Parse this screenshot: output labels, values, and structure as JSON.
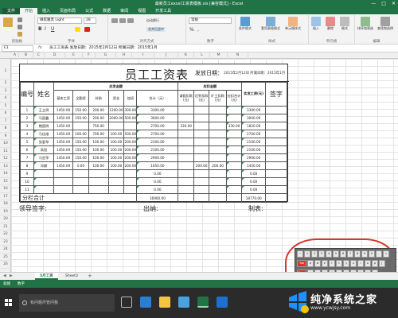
{
  "window": {
    "title": "最新员工excel工资表模板.xls [兼容模式] - Excel",
    "btn_min": "—",
    "btn_max": "□",
    "btn_close": "✕"
  },
  "ribbon_tabs": [
    "文件",
    "开始",
    "插入",
    "页面布局",
    "公式",
    "数据",
    "审阅",
    "视图",
    "开发工具"
  ],
  "ribbon": {
    "font_name": "微软雅黑 Light",
    "font_size": "28",
    "groups": [
      "剪贴板",
      "字体",
      "对齐方式",
      "数字",
      "样式",
      "单元格",
      "编辑"
    ],
    "wrap_text": "自动换行",
    "merge_center": "合并后居中",
    "number_format": "常规",
    "cond_format": "条件格式",
    "table_format": "套用表格格式",
    "cell_style": "单元格样式",
    "insert": "插入",
    "delete": "删除",
    "format": "格式",
    "sort_filter": "排序和筛选",
    "find_select": "查找和选择"
  },
  "formula_bar": {
    "name_box": "E1",
    "fx": "fx",
    "content": "员工工资表   发放日期：2015年2月12日 所属日期：2015年1月"
  },
  "columns": [
    "A",
    "B",
    "C",
    "D",
    "E",
    "F",
    "G",
    "H",
    "I",
    "J",
    "K",
    "L",
    "M",
    "N"
  ],
  "rows": [
    "1",
    "2",
    "3",
    "4",
    "5",
    "6",
    "7",
    "8",
    "9",
    "10",
    "11",
    "12",
    "13",
    "14",
    "15",
    "16",
    "17",
    "18",
    "19",
    "20",
    "21",
    "22",
    "23",
    "24",
    "25",
    "26",
    "27",
    "28",
    "29"
  ],
  "sheet": {
    "title": "员工工资表",
    "issue_label": "发放日期：",
    "issue_value": "2015年2月12日 所属日期：2015年1月",
    "headers": {
      "index": "编号",
      "name": "姓名",
      "payable": "应发金额",
      "deduct": "应扣金额",
      "base": "基本工资",
      "full_attend": "全勤奖",
      "subsidy": "补助",
      "bonus": "奖金",
      "overtime": "加班",
      "total": "合计（元）",
      "leave": "请假扣款(元)",
      "late": "迟到扣款(元)",
      "absent": "旷工扣款(元)",
      "deduct_total": "应扣合计(元)",
      "net": "实发工资(元)",
      "sign": "签字"
    },
    "rows": [
      {
        "no": "1",
        "name": "王立明",
        "base": "1450.00",
        "full": "150.00",
        "sub": "200.00",
        "bonus": "1200.00",
        "ot": "300.00",
        "total": "3300.00",
        "leave": "",
        "late": "",
        "absent": "",
        "dtotal": "",
        "net": "3300.00"
      },
      {
        "no": "2",
        "name": "马国鑫",
        "base": "1450.00",
        "full": "150.00",
        "sub": "200.00",
        "bonus": "2000.00",
        "ot": "500.00",
        "total": "3000.00",
        "leave": "",
        "late": "",
        "absent": "",
        "dtotal": "",
        "net": "3000.00"
      },
      {
        "no": "3",
        "name": "鲍国明",
        "base": "1450.00",
        "full": "",
        "sub": "750.00",
        "bonus": "",
        "ot": "",
        "total": "2700.00",
        "leave": "330.00",
        "late": "",
        "absent": "",
        "dtotal": "330.00",
        "net": "1820.00"
      },
      {
        "no": "4",
        "name": "马佳维",
        "base": "1450.00",
        "full": "100.00",
        "sub": "700.00",
        "bonus": "100.00",
        "ot": "500.00",
        "total": "2700.00",
        "leave": "",
        "late": "",
        "absent": "",
        "dtotal": "",
        "net": "2700.00"
      },
      {
        "no": "5",
        "name": "张爱琴",
        "base": "1450.00",
        "full": "150.00",
        "sub": "100.00",
        "bonus": "100.00",
        "ot": "200.00",
        "total": "2100.00",
        "leave": "",
        "late": "",
        "absent": "",
        "dtotal": "",
        "net": "2100.00"
      },
      {
        "no": "6",
        "name": "高阳",
        "base": "1450.00",
        "full": "150.00",
        "sub": "100.00",
        "bonus": "100.00",
        "ot": "200.00",
        "total": "2100.00",
        "leave": "",
        "late": "",
        "absent": "",
        "dtotal": "",
        "net": "2100.00"
      },
      {
        "no": "7",
        "name": "马亚萍",
        "base": "1450.00",
        "full": "150.00",
        "sub": "100.00",
        "bonus": "100.00",
        "ot": "200.00",
        "total": "2900.00",
        "leave": "",
        "late": "",
        "absent": "",
        "dtotal": "",
        "net": "2900.00"
      },
      {
        "no": "8",
        "name": "邓娜",
        "base": "1450.00",
        "full": "0.00",
        "sub": "100.00",
        "bonus": "100.00",
        "ot": "200.00",
        "total": "1650.00",
        "leave": "",
        "late": "200.00",
        "absent": "200.00",
        "dtotal": "",
        "net": "1450.00"
      },
      {
        "no": "9",
        "name": "",
        "base": "",
        "full": "",
        "sub": "",
        "bonus": "",
        "ot": "",
        "total": "0.00",
        "leave": "",
        "late": "",
        "absent": "",
        "dtotal": "",
        "net": "0.00"
      },
      {
        "no": "10",
        "name": "",
        "base": "",
        "full": "",
        "sub": "",
        "bonus": "",
        "ot": "",
        "total": "0.00",
        "leave": "",
        "late": "",
        "absent": "",
        "dtotal": "",
        "net": "0.00"
      },
      {
        "no": "11",
        "name": "",
        "base": "",
        "full": "",
        "sub": "",
        "bonus": "",
        "ot": "",
        "total": "0.00",
        "leave": "",
        "late": "",
        "absent": "",
        "dtotal": "",
        "net": "0.00"
      }
    ],
    "subtotal_label": "分栏合计",
    "subtotal_total": "16900.00",
    "subtotal_net": "18770.00"
  },
  "signatures": {
    "leader": "领导签字:",
    "cashier": "出纳:",
    "maker": "制表:"
  },
  "keyboard": {
    "row1": [
      "~",
      "1",
      "2",
      "3",
      "4",
      "5",
      "6",
      "7",
      "8",
      "9",
      "0",
      "-",
      "="
    ],
    "row2": [
      "Tab",
      "q",
      "w",
      "e",
      "r",
      "t",
      "y",
      "u",
      "i",
      "o",
      "p",
      "["
    ],
    "row3": [
      "Caps",
      "a",
      "s",
      "d",
      "f",
      "g",
      "h",
      "j",
      "k",
      "l",
      ";"
    ],
    "row4": [
      "Shift",
      "z",
      "x",
      "c",
      "v",
      "b",
      "n",
      "m",
      ",",
      "."
    ]
  },
  "sheet_tabs": {
    "active": "5月工资",
    "other": "Sheet3",
    "add": "+"
  },
  "statusbar": {
    "left": "就绪",
    "mode": "数字"
  },
  "taskbar": {
    "cortana": "有问题尽管问我"
  },
  "watermark": {
    "brand": "纯净系统之家",
    "url": "www.ycwjsy.com"
  },
  "colors": {
    "excel_green": "#217346",
    "accent_red": "#d9362f"
  }
}
